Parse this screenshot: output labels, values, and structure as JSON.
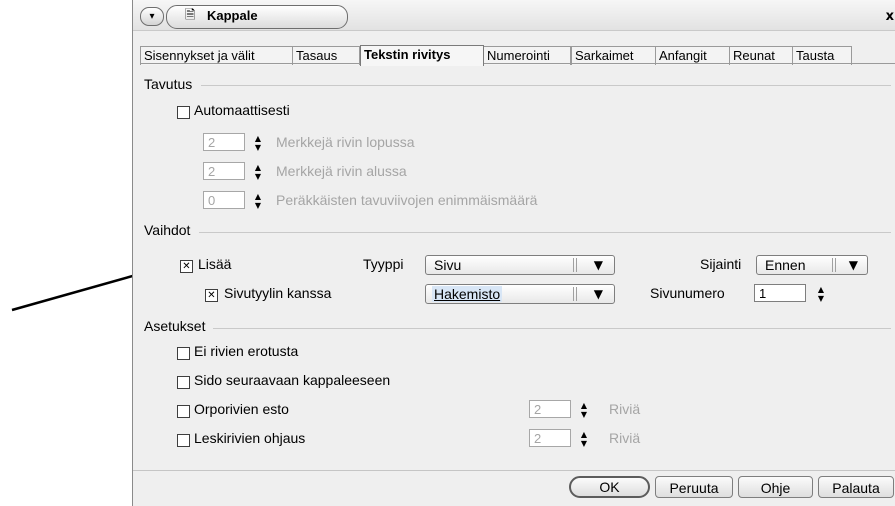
{
  "window": {
    "title": "Kappale",
    "close": "x"
  },
  "tabs": [
    {
      "label": "Sisennykset ja välit",
      "active": false
    },
    {
      "label": "Tasaus",
      "active": false
    },
    {
      "label": "Tekstin rivitys",
      "active": true
    },
    {
      "label": "Numerointi",
      "active": false
    },
    {
      "label": "Sarkaimet",
      "active": false
    },
    {
      "label": "Anfangit",
      "active": false
    },
    {
      "label": "Reunat",
      "active": false
    },
    {
      "label": "Tausta",
      "active": false
    }
  ],
  "hyphenation": {
    "section_title": "Tavutus",
    "automatic_label": "Automaattisesti",
    "automatic_checked": false,
    "chars_line_end": {
      "value": "2",
      "label": "Merkkejä rivin lopussa"
    },
    "chars_line_start": {
      "value": "2",
      "label": "Merkkejä rivin alussa"
    },
    "max_hyphens": {
      "value": "0",
      "label": "Peräkkäisten tavuviivojen enimmäismäärä"
    }
  },
  "breaks": {
    "section_title": "Vaihdot",
    "insert_label": "Lisää",
    "insert_checked": true,
    "type_label": "Tyyppi",
    "type_value": "Sivu",
    "position_label": "Sijainti",
    "position_value": "Ennen",
    "page_style_label": "Sivutyylin kanssa",
    "page_style_checked": true,
    "page_style_value": "Hakemisto",
    "page_number_label": "Sivunumero",
    "page_number_value": "1"
  },
  "options": {
    "section_title": "Asetukset",
    "no_split_label": "Ei rivien erotusta",
    "keep_with_next_label": "Sido seuraavaan kappaleeseen",
    "orphan_label": "Orporivien esto",
    "orphan_value": "2",
    "orphan_unit": "Riviä",
    "widow_label": "Leskirivien ohjaus",
    "widow_value": "2",
    "widow_unit": "Riviä"
  },
  "buttons": {
    "ok": "OK",
    "cancel": "Peruuta",
    "help": "Ohje",
    "reset": "Palauta"
  }
}
